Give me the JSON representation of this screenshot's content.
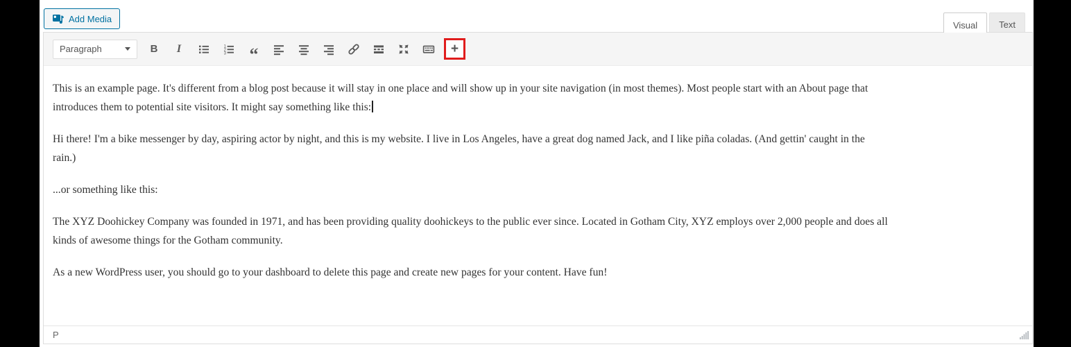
{
  "add_media": {
    "label": "Add Media"
  },
  "tabs": {
    "visual": "Visual",
    "text": "Text"
  },
  "toolbar": {
    "paragraph_label": "Paragraph",
    "glyphs": {
      "bold": "B",
      "italic": "I",
      "blockquote": "“",
      "plus": "+"
    },
    "buttons": [
      "bold",
      "italic",
      "bulleted-list",
      "numbered-list",
      "blockquote",
      "align-left",
      "align-center",
      "align-right",
      "link",
      "more-tag",
      "fullscreen",
      "toolbar-toggle",
      "insert-plus"
    ],
    "highlighted_button": "insert-plus"
  },
  "editor": {
    "paragraphs": [
      [
        "This is an example page. It's different from a blog post because it will stay in one place and will show up in your site navigation (in most themes). Most people start with an About page that",
        "introduces them to potential site visitors. It might say something like this:"
      ],
      [
        "Hi there! I'm a bike messenger by day, aspiring actor by night, and this is my website. I live in Los Angeles, have a great dog named Jack, and I like piña coladas. (And gettin' caught in the",
        "rain.)"
      ],
      [
        "...or something like this:"
      ],
      [
        "The XYZ Doohickey Company was founded in 1971, and has been providing quality doohickeys to the public ever since. Located in Gotham City, XYZ employs over 2,000 people and does all",
        "kinds of awesome things for the Gotham community."
      ],
      [
        "As a new WordPress user, you should go to your dashboard to delete this page and create new pages for your content. Have fun!"
      ]
    ],
    "caret": {
      "paragraph": 0,
      "line": 1
    }
  },
  "statusbar": {
    "path": "P"
  },
  "colors": {
    "accent_blue": "#0071a1",
    "highlight_red": "#e01c1c",
    "toolbar_bg": "#f5f5f5",
    "text": "#333333"
  }
}
